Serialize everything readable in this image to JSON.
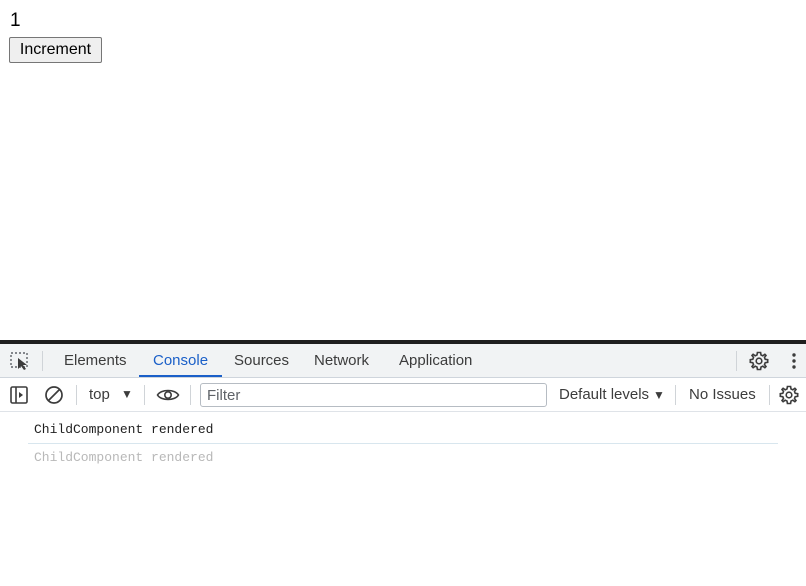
{
  "page": {
    "counter_value": "1",
    "increment_label": "Increment"
  },
  "devtools": {
    "tabs": [
      {
        "label": "Elements"
      },
      {
        "label": "Console",
        "active": true
      },
      {
        "label": "Sources"
      },
      {
        "label": "Network"
      },
      {
        "label": "Application"
      }
    ],
    "toolbar": {
      "context": "top",
      "filter_placeholder": "Filter",
      "levels_label": "Default levels",
      "issues_label": "No Issues"
    },
    "console": {
      "messages": [
        {
          "text": "ChildComponent rendered"
        },
        {
          "text": "ChildComponent rendered"
        }
      ]
    },
    "accent_color": "#1a5fc8",
    "icons": [
      "inspect-element-icon",
      "settings-gear-icon",
      "more-options-icon",
      "sidebar-toggle-icon",
      "clear-console-icon",
      "dropdown-arrow-icon",
      "eye-icon"
    ]
  }
}
